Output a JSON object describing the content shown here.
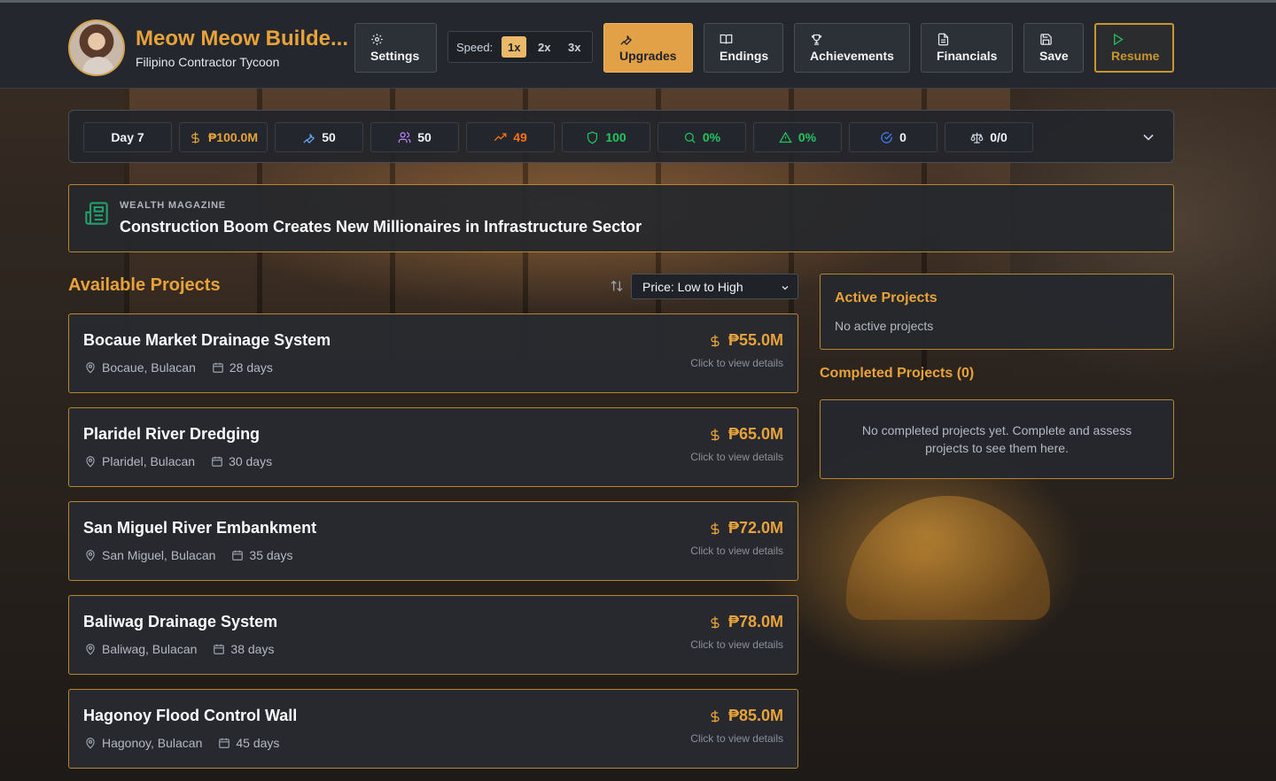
{
  "header": {
    "title": "Meow Meow Builde...",
    "subtitle": "Filipino Contractor Tycoon",
    "settings_label": "Settings",
    "speed_label": "Speed:",
    "speed_options": [
      "1x",
      "2x",
      "3x"
    ],
    "speed_selected": "1x",
    "upgrades_label": "Upgrades",
    "endings_label": "Endings",
    "achievements_label": "Achievements",
    "financials_label": "Financials",
    "save_label": "Save",
    "resume_label": "Resume"
  },
  "stats": {
    "day": "Day 7",
    "money": "₱100.0M",
    "skill": "50",
    "team": "50",
    "reputation": "49",
    "integrity": "100",
    "investigation": "0%",
    "risk": "0%",
    "completed": "0",
    "cases": "0/0",
    "colors": {
      "money": "#e7a33a",
      "skill": "#60a5fa",
      "team": "#c084fc",
      "reputation": "#f97316",
      "integrity": "#22c55e",
      "investigation": "#22c55e",
      "risk": "#22c55e",
      "completed": "#3b82f6",
      "cases": "#cbd5e1"
    }
  },
  "news": {
    "source": "WEALTH MAGAZINE",
    "headline": "Construction Boom Creates New Millionaires in Infrastructure Sector"
  },
  "available": {
    "title": "Available Projects",
    "sort_selected": "Price: Low to High",
    "projects": [
      {
        "name": "Bocaue Market Drainage System",
        "location": "Bocaue, Bulacan",
        "duration": "28 days",
        "price": "₱55.0M",
        "hint": "Click to view details"
      },
      {
        "name": "Plaridel River Dredging",
        "location": "Plaridel, Bulacan",
        "duration": "30 days",
        "price": "₱65.0M",
        "hint": "Click to view details"
      },
      {
        "name": "San Miguel River Embankment",
        "location": "San Miguel, Bulacan",
        "duration": "35 days",
        "price": "₱72.0M",
        "hint": "Click to view details"
      },
      {
        "name": "Baliwag Drainage System",
        "location": "Baliwag, Bulacan",
        "duration": "38 days",
        "price": "₱78.0M",
        "hint": "Click to view details"
      },
      {
        "name": "Hagonoy Flood Control Wall",
        "location": "Hagonoy, Bulacan",
        "duration": "45 days",
        "price": "₱85.0M",
        "hint": "Click to view details"
      }
    ]
  },
  "active": {
    "title": "Active Projects",
    "empty": "No active projects"
  },
  "completed_section": {
    "title": "Completed Projects (0)",
    "empty": "No completed projects yet. Complete and assess projects to see them here."
  }
}
